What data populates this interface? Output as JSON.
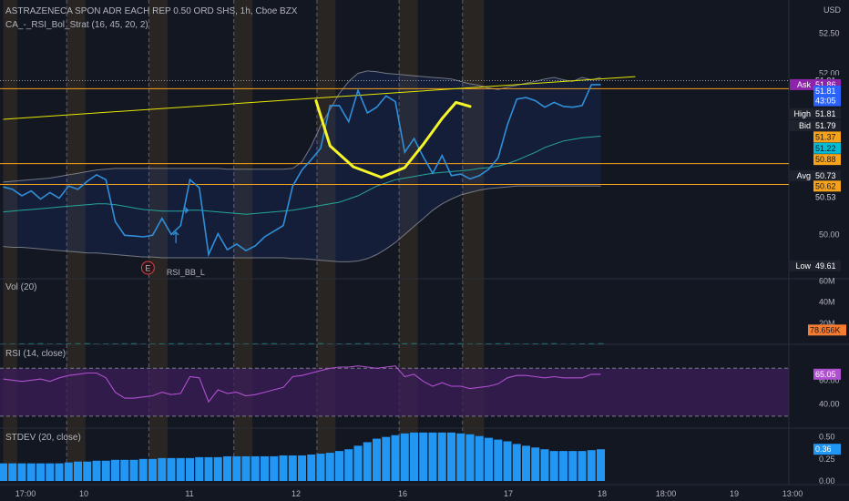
{
  "header": {
    "symbol_line": "ASTRAZENECA SPON ADR EACH REP 0.50 ORD SHS, 1h, Cboe BZX",
    "indicator_line": "CA_-_RSI_Bol_Strat (16, 45, 20, 2)",
    "currency": "USD"
  },
  "colors": {
    "background": "#131722",
    "price_line": "#2f8fd8",
    "bb_band": "#b2b5be",
    "bb_basis": "#26a69a",
    "trendline": "#e6e600",
    "hlines": "#f7a21b",
    "session_shade": "#3a3224",
    "rsi_fill": "#3b1e5a",
    "rsi_line": "#b04fd0",
    "stdev_bars": "#2196f3"
  },
  "chart_data": [
    {
      "type": "line",
      "panel": "price",
      "y_ticks": [
        "52.50",
        "52.00",
        "50.00"
      ],
      "ylim": [
        49.45,
        52.73
      ],
      "x_labels": [
        "17:00",
        "10",
        "11",
        "12",
        "16",
        "17",
        "18",
        "18:00",
        "19",
        "13:00"
      ],
      "series": [
        {
          "role": "price",
          "values": [
            50.59,
            50.56,
            50.48,
            50.54,
            50.44,
            50.52,
            50.45,
            50.6,
            50.56,
            50.66,
            50.74,
            50.68,
            50.16,
            49.99,
            49.98,
            49.97,
            49.99,
            50.2,
            50.0,
            50.11,
            50.68,
            50.58,
            49.75,
            50.01,
            49.81,
            49.88,
            49.8,
            49.86,
            49.97,
            50.04,
            50.11,
            50.6,
            50.8,
            50.93,
            51.07,
            51.6,
            51.6,
            51.4,
            51.79,
            51.51,
            51.58,
            51.72,
            51.65,
            51.02,
            51.19,
            50.96,
            50.76,
            50.98,
            50.73,
            50.75,
            50.69,
            50.73,
            50.81,
            50.95,
            51.36,
            51.68,
            51.7,
            51.66,
            51.58,
            51.64,
            51.59,
            51.58,
            51.6,
            51.86,
            51.86
          ]
        },
        {
          "role": "bb_upper",
          "values": [
            50.65,
            50.66,
            50.67,
            50.68,
            50.69,
            50.7,
            50.72,
            50.74,
            50.76,
            50.78,
            50.8,
            50.81,
            50.82,
            50.82,
            50.82,
            50.82,
            50.82,
            50.82,
            50.82,
            50.82,
            50.82,
            50.82,
            50.82,
            50.82,
            50.81,
            50.81,
            50.81,
            50.81,
            50.81,
            50.81,
            50.81,
            50.82,
            50.9,
            51.1,
            51.35,
            51.55,
            51.75,
            51.9,
            52.0,
            52.03,
            52.02,
            52.0,
            51.99,
            51.98,
            51.97,
            51.96,
            51.95,
            51.94,
            51.93,
            51.9,
            51.87,
            51.85,
            51.82,
            51.8,
            51.83,
            51.85,
            51.88,
            51.9,
            51.93,
            51.95,
            51.92,
            51.9,
            51.95,
            51.92,
            51.95
          ]
        },
        {
          "role": "bb_basis",
          "values": [
            50.28,
            50.29,
            50.3,
            50.31,
            50.32,
            50.33,
            50.34,
            50.35,
            50.36,
            50.37,
            50.38,
            50.38,
            50.37,
            50.35,
            50.33,
            50.31,
            50.3,
            50.29,
            50.29,
            50.29,
            50.3,
            50.3,
            50.29,
            50.28,
            50.27,
            50.26,
            50.25,
            50.26,
            50.27,
            50.28,
            50.29,
            50.3,
            50.32,
            50.34,
            50.36,
            50.38,
            50.4,
            50.44,
            50.48,
            50.54,
            50.6,
            50.64,
            50.68,
            50.7,
            50.72,
            50.74,
            50.76,
            50.77,
            50.78,
            50.79,
            50.8,
            50.82,
            50.83,
            50.85,
            50.88,
            50.92,
            50.97,
            51.02,
            51.08,
            51.12,
            51.16,
            51.18,
            51.2,
            51.21,
            51.22
          ]
        },
        {
          "role": "bb_lower",
          "values": [
            49.85,
            49.84,
            49.84,
            49.83,
            49.82,
            49.81,
            49.8,
            49.79,
            49.78,
            49.77,
            49.77,
            49.76,
            49.75,
            49.74,
            49.73,
            49.72,
            49.72,
            49.71,
            49.71,
            49.71,
            49.71,
            49.71,
            49.71,
            49.71,
            49.71,
            49.71,
            49.71,
            49.71,
            49.71,
            49.71,
            49.71,
            49.7,
            49.7,
            49.69,
            49.68,
            49.67,
            49.66,
            49.66,
            49.67,
            49.7,
            49.75,
            49.82,
            49.9,
            50.0,
            50.1,
            50.2,
            50.3,
            50.38,
            50.44,
            50.49,
            50.52,
            50.55,
            50.57,
            50.58,
            50.59,
            50.6,
            50.6,
            50.6,
            50.6,
            50.6,
            50.6,
            50.6,
            50.6,
            50.6,
            50.6
          ]
        }
      ],
      "cup_curve": {
        "x": [
          33.5,
          35.0,
          37.5,
          40.5,
          43.0,
          45.0,
          47.0,
          48.5,
          50.0
        ],
        "y": [
          51.66,
          51.1,
          50.84,
          50.71,
          50.83,
          51.12,
          51.44,
          51.64,
          51.59
        ]
      },
      "trendline": {
        "from": [
          0,
          51.43
        ],
        "to": [
          67.7,
          51.96
        ]
      },
      "hlines": [
        51.91,
        51.81,
        50.88,
        50.62
      ],
      "price_labels": [
        {
          "value": "51.91",
          "y": 51.91,
          "style": "plain"
        },
        {
          "name": "Ask",
          "value": "51.86",
          "y": 51.86,
          "style": "ask"
        },
        {
          "value": "51.81",
          "y": 51.78,
          "style": "blue"
        },
        {
          "value": "43:05",
          "y": 51.66,
          "style": "blue"
        },
        {
          "name": "High",
          "value": "51.81",
          "y": 51.5,
          "style": "dark"
        },
        {
          "name": "Bid",
          "value": "51.79",
          "y": 51.35,
          "style": "dark"
        },
        {
          "value": "51.37",
          "y": 51.21,
          "style": "orange"
        },
        {
          "value": "51.22",
          "y": 51.07,
          "style": "teal"
        },
        {
          "value": "50.88",
          "y": 50.93,
          "style": "orange"
        },
        {
          "name": "Avg",
          "value": "50.73",
          "y": 50.73,
          "style": "dark"
        },
        {
          "value": "50.62",
          "y": 50.6,
          "style": "orange"
        },
        {
          "value": "50.53",
          "y": 50.46,
          "style": "plain"
        },
        {
          "name": "Low",
          "value": "49.61",
          "y": 49.61,
          "style": "dark"
        }
      ],
      "event_marker": {
        "label": "E",
        "bar": 15.5
      },
      "signals": [
        {
          "type": "up",
          "bar": 18.5,
          "y": 49.96
        },
        {
          "type": "right",
          "bar": 19.5,
          "y": 50.3
        }
      ],
      "signal_text": "RSI_BB_L",
      "day_separators": [
        6.8,
        15.6,
        24.7,
        33.6,
        42.4,
        49.2
      ]
    },
    {
      "type": "bar",
      "panel": "volume",
      "title": "Vol (20)",
      "y_ticks": [
        "60M",
        "40M",
        "20M"
      ],
      "ylim": [
        0,
        62
      ],
      "value_tag": "78.656K"
    },
    {
      "type": "line",
      "panel": "rsi",
      "title": "RSI (14, close)",
      "y_ticks": [
        "60.00",
        "40.00"
      ],
      "ylim": [
        20,
        90
      ],
      "bands": [
        70,
        30
      ],
      "values": [
        61,
        60,
        59,
        60,
        61,
        59,
        62,
        64,
        65,
        66,
        66,
        62,
        50,
        45,
        45,
        46,
        47,
        50,
        48,
        49,
        63,
        62,
        42,
        52,
        49,
        50,
        47,
        48,
        50,
        52,
        54,
        63,
        64,
        66,
        68,
        70,
        71,
        71,
        72,
        71,
        70,
        71,
        72,
        63,
        65,
        59,
        55,
        58,
        55,
        55,
        53,
        54,
        55,
        57,
        62,
        64,
        64,
        63,
        62,
        63,
        62,
        62,
        62,
        65,
        65
      ],
      "value_tag": "65.05"
    },
    {
      "type": "bar",
      "panel": "stdev",
      "title": "STDEV (20, close)",
      "y_ticks": [
        "0.50",
        "0.25",
        "0.00"
      ],
      "ylim": [
        0,
        0.6
      ],
      "values": [
        0.2,
        0.2,
        0.2,
        0.2,
        0.2,
        0.2,
        0.2,
        0.21,
        0.22,
        0.22,
        0.23,
        0.23,
        0.24,
        0.24,
        0.24,
        0.25,
        0.25,
        0.26,
        0.26,
        0.26,
        0.26,
        0.27,
        0.27,
        0.27,
        0.28,
        0.28,
        0.28,
        0.28,
        0.28,
        0.28,
        0.29,
        0.29,
        0.29,
        0.3,
        0.31,
        0.32,
        0.34,
        0.36,
        0.4,
        0.44,
        0.48,
        0.5,
        0.52,
        0.54,
        0.55,
        0.55,
        0.55,
        0.55,
        0.55,
        0.54,
        0.53,
        0.51,
        0.49,
        0.47,
        0.45,
        0.42,
        0.4,
        0.38,
        0.36,
        0.34,
        0.34,
        0.34,
        0.34,
        0.35,
        0.36
      ],
      "value_tag": "0.36"
    }
  ]
}
